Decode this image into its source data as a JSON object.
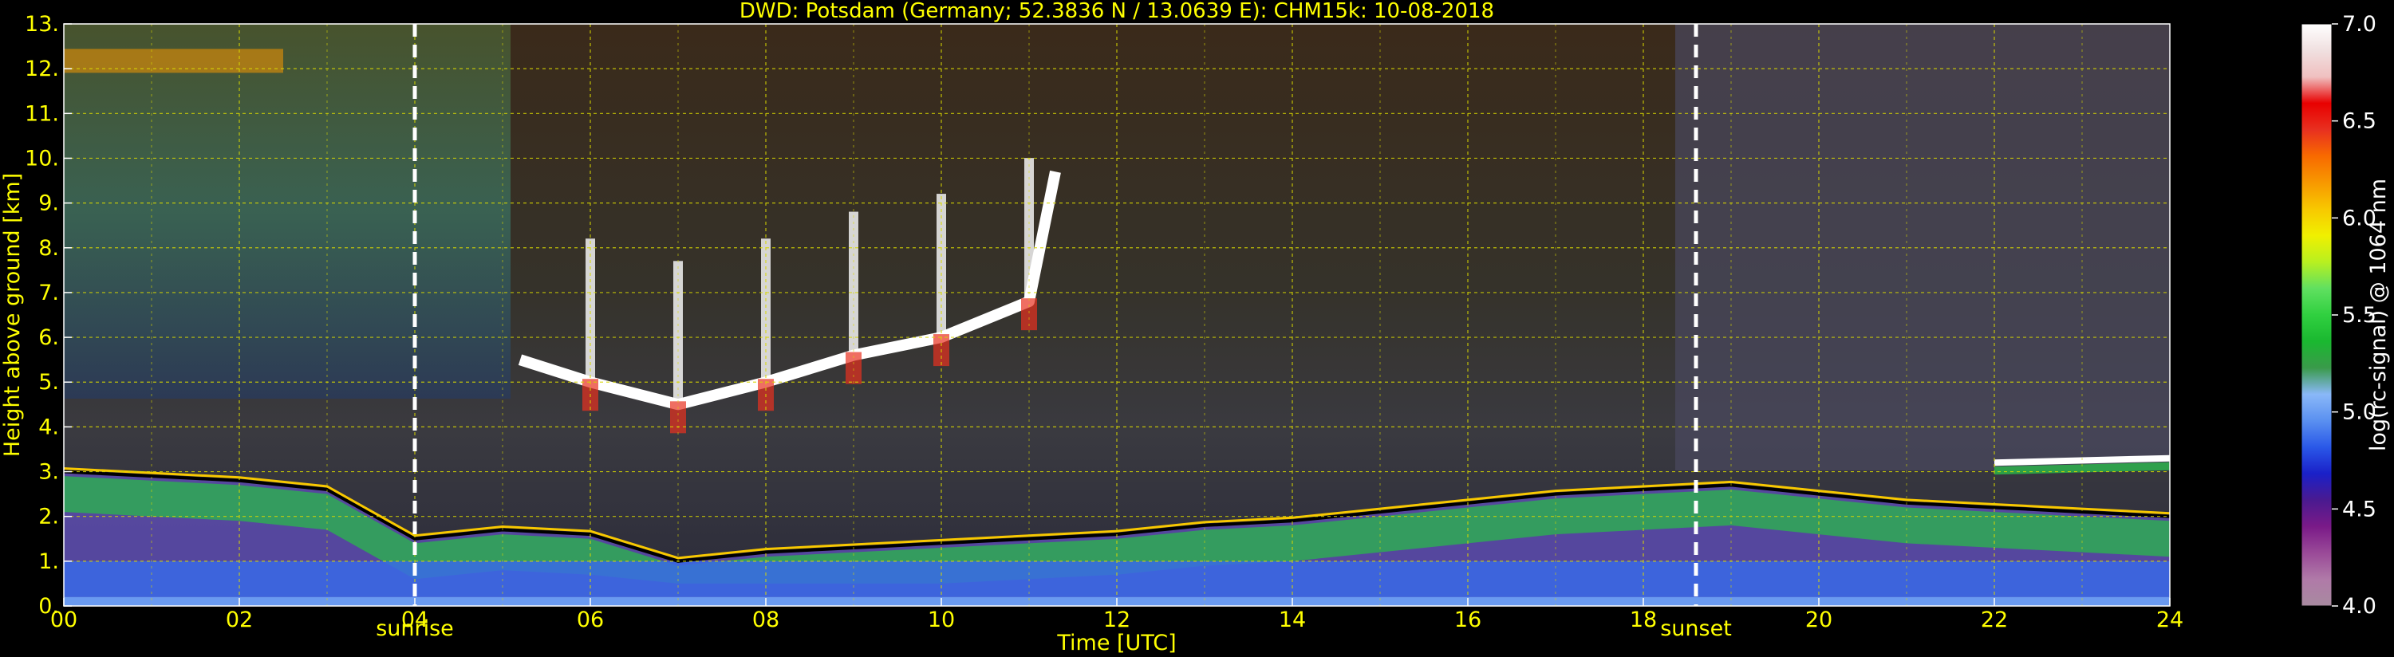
{
  "title": "DWD: Potsdam (Germany; 52.3836 N / 13.0639 E):    CHM15k: 10-08-2018",
  "chart_data": {
    "type": "heatmap",
    "title": "DWD: Potsdam (Germany; 52.3836 N / 13.0639 E):    CHM15k: 10-08-2018",
    "xlabel": "Time [UTC]",
    "ylabel": "Height above ground [km]",
    "xlim": [
      0,
      24
    ],
    "ylim": [
      0,
      13
    ],
    "x_ticks": [
      0,
      2,
      4,
      6,
      8,
      10,
      12,
      14,
      16,
      18,
      20,
      22,
      24
    ],
    "x_tick_labels": [
      "00",
      "02",
      "04",
      "06",
      "08",
      "10",
      "12",
      "14",
      "16",
      "18",
      "20",
      "22",
      "24"
    ],
    "y_ticks": [
      0,
      1,
      2,
      3,
      4,
      5,
      6,
      7,
      8,
      9,
      10,
      11,
      12,
      13
    ],
    "y_tick_labels": [
      "0.",
      "1.",
      "2.",
      "3.",
      "4.",
      "5.",
      "6.",
      "7.",
      "8.",
      "9.",
      "10.",
      "11.",
      "12.",
      "13."
    ],
    "grid": true,
    "annotations": [
      {
        "label": "sunrise",
        "x": 4.0
      },
      {
        "label": "sunset",
        "x": 18.6
      }
    ],
    "colorbar": {
      "label": "log(rc-signal) @ 1064 nm",
      "range": [
        4.0,
        7.0
      ],
      "ticks": [
        4.0,
        4.5,
        5.0,
        5.5,
        6.0,
        6.5,
        7.0
      ],
      "tick_labels": [
        "4.0",
        "4.5",
        "5.0",
        "5.5",
        "6.0",
        "6.5",
        "7.0"
      ],
      "colors": [
        "#a88aa0",
        "#b07aa8",
        "#9a4a98",
        "#7a1a88",
        "#4a1a90",
        "#1a20c8",
        "#2a58e8",
        "#5a90f0",
        "#8ab8f8",
        "#3a9a4a",
        "#1ab830",
        "#30d040",
        "#60e060",
        "#b8f020",
        "#f0f000",
        "#f8c800",
        "#f89800",
        "#f86a00",
        "#e83020",
        "#e80000",
        "#f0c0c0",
        "#f0e0e0",
        "#ffffff"
      ]
    },
    "features": [
      {
        "feature": "boundary_layer_top",
        "times": [
          0,
          1,
          2,
          3,
          4,
          5,
          6,
          7,
          8,
          9,
          10,
          11,
          12,
          13,
          14,
          15,
          16,
          17,
          18,
          19,
          20,
          21,
          22,
          23,
          24
        ],
        "heights_km": [
          3.0,
          2.9,
          2.8,
          2.6,
          1.5,
          1.7,
          1.6,
          1.0,
          1.2,
          1.3,
          1.4,
          1.5,
          1.6,
          1.8,
          1.9,
          2.1,
          2.3,
          2.5,
          2.6,
          2.7,
          2.5,
          2.3,
          2.2,
          2.1,
          2.0
        ]
      },
      {
        "feature": "mid_level_cloud",
        "times": [
          5.2,
          6.0,
          7.0,
          8.0,
          9.0,
          10.0,
          11.0,
          11.3
        ],
        "heights_km": [
          5.5,
          5.0,
          4.5,
          5.0,
          5.6,
          6.0,
          6.8,
          9.7
        ]
      },
      {
        "feature": "cirrus_top",
        "times": [
          0,
          2.5
        ],
        "heights_km": [
          12.3,
          12.3
        ]
      },
      {
        "feature": "upper_layer",
        "times": [
          22.0,
          24.0
        ],
        "heights_km": [
          3.2,
          3.3
        ]
      }
    ]
  }
}
